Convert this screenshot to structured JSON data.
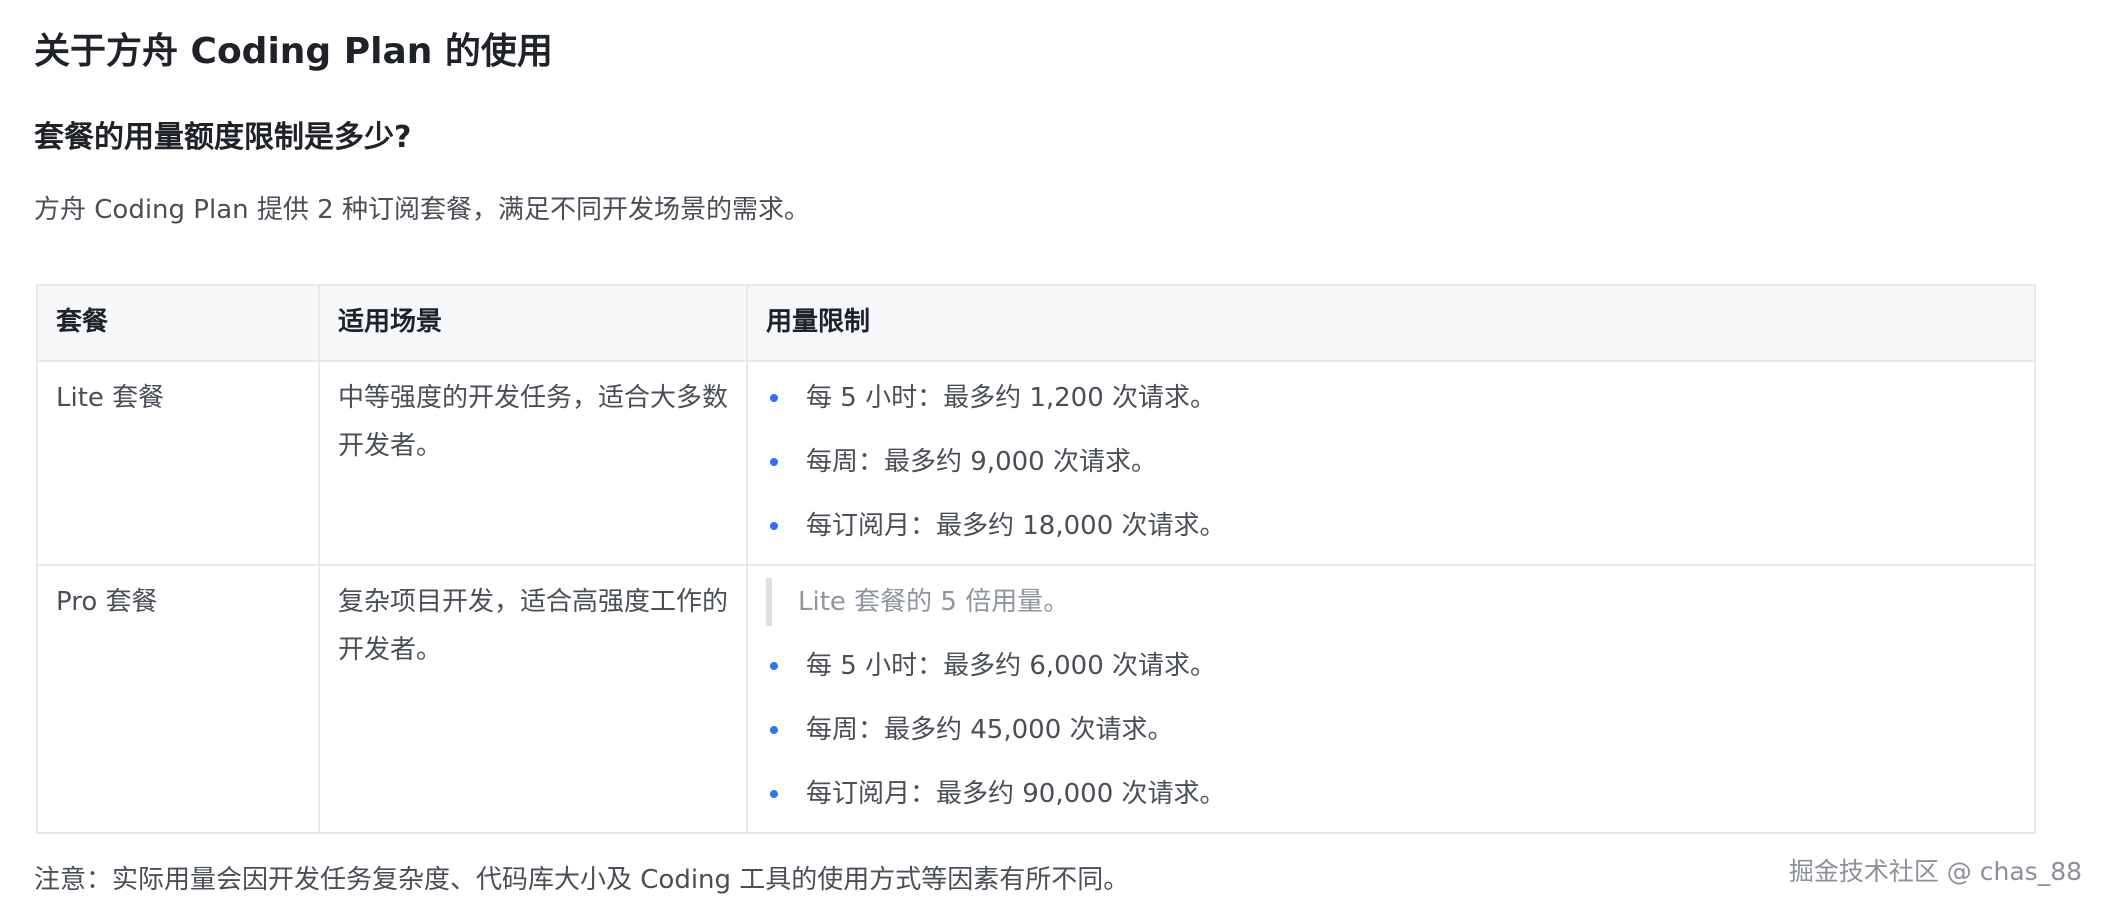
{
  "title": "关于方舟 Coding Plan 的使用",
  "section_heading": "套餐的用量额度限制是多少?",
  "intro": "方舟 Coding Plan 提供 2 种订阅套餐，满足不同开发场景的需求。",
  "table": {
    "headers": [
      "套餐",
      "适用场景",
      "用量限制"
    ],
    "rows": [
      {
        "plan": "Lite 套餐",
        "scenario": "中等强度的开发任务，适合大多数开发者。",
        "quote": "",
        "limits": [
          "每 5 小时：最多约 1,200 次请求。",
          "每周：最多约 9,000 次请求。",
          "每订阅月：最多约 18,000 次请求。"
        ]
      },
      {
        "plan": "Pro 套餐",
        "scenario": "复杂项目开发，适合高强度工作的开发者。",
        "quote": "Lite 套餐的 5 倍用量。",
        "limits": [
          "每 5 小时：最多约 6,000 次请求。",
          "每周：最多约 45,000 次请求。",
          "每订阅月：最多约 90,000 次请求。"
        ]
      }
    ]
  },
  "note": "注意：实际用量会因开发任务复杂度、代码库大小及 Coding 工具的使用方式等因素有所不同。",
  "watermark": "掘金技术社区 @ chas_88",
  "colors": {
    "bullet": "#3370ff",
    "header_bg": "#f6f7f9",
    "border": "#e7e9ec"
  }
}
